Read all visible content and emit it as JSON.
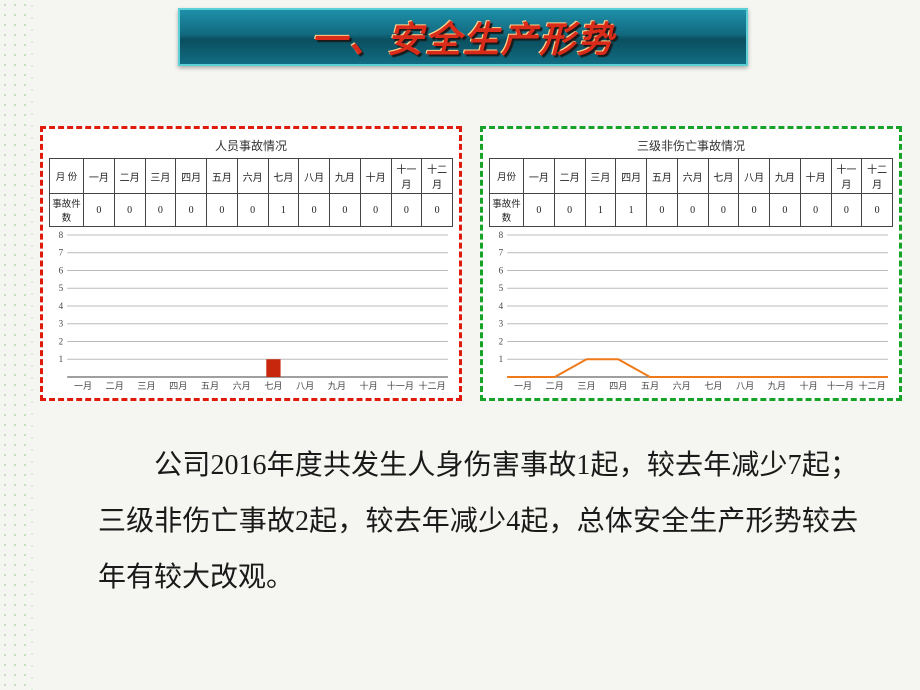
{
  "title": "一、安全生产形势",
  "chart_data": [
    {
      "type": "bar",
      "title": "人员事故情况",
      "header_label": "月 份",
      "row_label": "事故件数",
      "categories": [
        "一月",
        "二月",
        "三月",
        "四月",
        "五月",
        "六月",
        "七月",
        "八月",
        "九月",
        "十月",
        "十一月",
        "十二月"
      ],
      "values": [
        0,
        0,
        0,
        0,
        0,
        0,
        1,
        0,
        0,
        0,
        0,
        0
      ],
      "ylim": [
        0,
        8
      ],
      "y_ticks": [
        1,
        2,
        3,
        4,
        5,
        6,
        7,
        8
      ],
      "xlabel": "",
      "ylabel": ""
    },
    {
      "type": "line",
      "title": "三级非伤亡事故情况",
      "header_label": "月份",
      "row_label": "事故件数",
      "categories": [
        "一月",
        "二月",
        "三月",
        "四月",
        "五月",
        "六月",
        "七月",
        "八月",
        "九月",
        "十月",
        "十一月",
        "十二月"
      ],
      "values": [
        0,
        0,
        1,
        1,
        0,
        0,
        0,
        0,
        0,
        0,
        0,
        0
      ],
      "ylim": [
        0,
        8
      ],
      "y_ticks": [
        1,
        2,
        3,
        4,
        5,
        6,
        7,
        8
      ],
      "xlabel": "",
      "ylabel": ""
    }
  ],
  "body": {
    "para": "公司2016年度共发生人身伤害事故1起，较去年减少7起；三级非伤亡事故2起，较去年减少4起，总体安全生产形势较去年有较大改观。"
  }
}
